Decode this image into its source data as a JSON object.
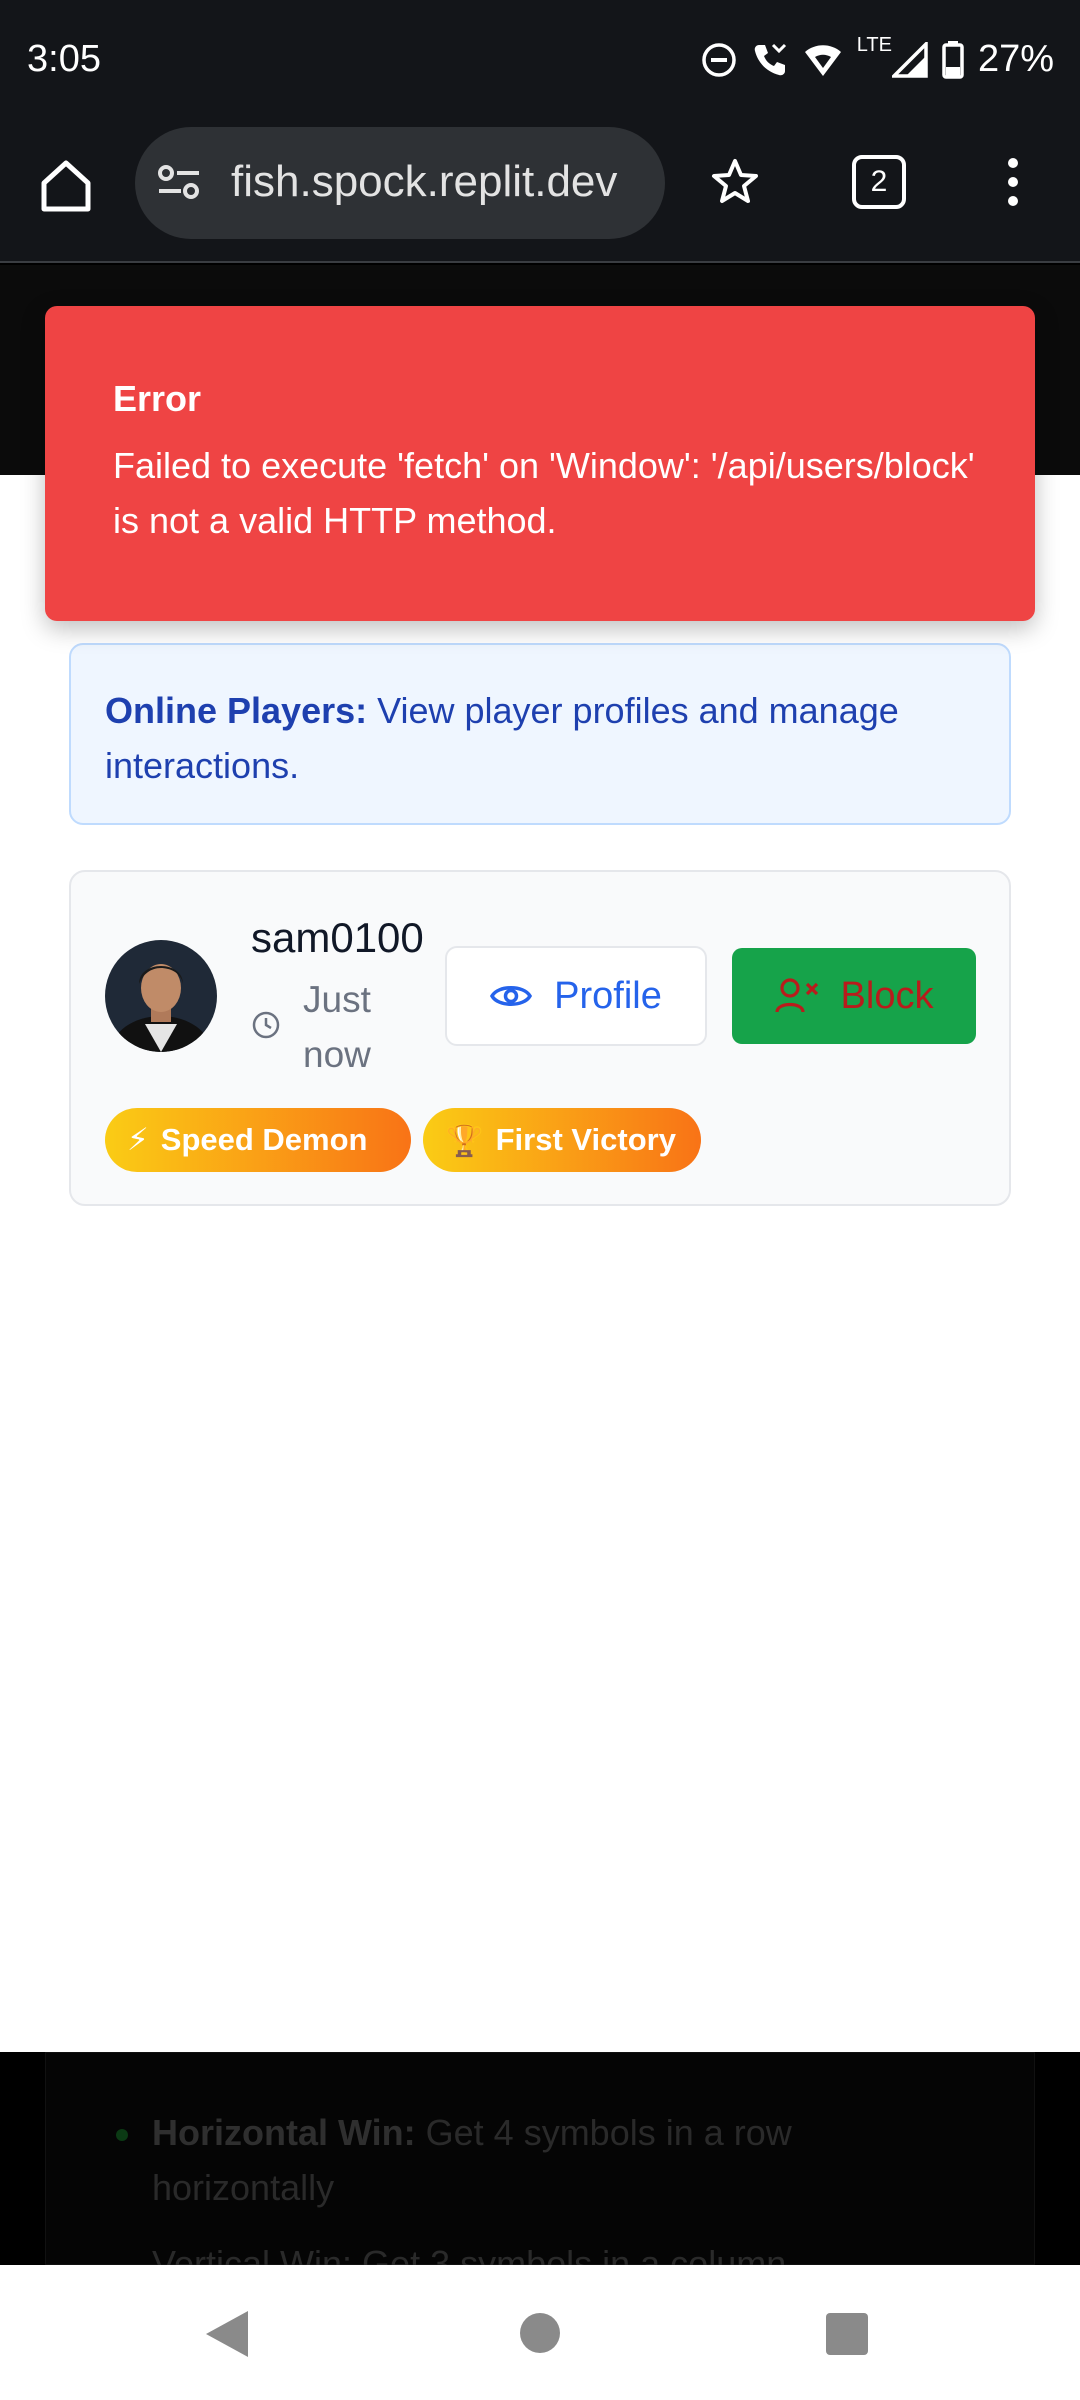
{
  "status_bar": {
    "time": "3:05",
    "network": "LTE",
    "battery": "27%"
  },
  "browser": {
    "url": "fish.spock.replit.dev",
    "tab_count": "2"
  },
  "toast": {
    "title": "Error",
    "message": "Failed to execute 'fetch' on 'Window': '/api/users/block' is not a valid HTTP method.",
    "color": "#ef4444"
  },
  "info_banner": {
    "label": "Online Players:",
    "text": " View player profiles and manage interactions."
  },
  "player": {
    "username": "sam0100",
    "last_seen": "Just now",
    "profile_label": "Profile",
    "block_label": "Block",
    "badges": [
      {
        "icon": "⚡",
        "label": "Speed Demon"
      },
      {
        "icon": "🏆",
        "label": "First Victory"
      }
    ]
  },
  "rules": {
    "item1_title": "Horizontal Win:",
    "item1_text": " Get 4 symbols in a row horizontally",
    "item2_text": "Vertical Win: Get 3 symbols in a column"
  },
  "colors": {
    "accent_blue": "#2563eb",
    "block_green": "#16a34a",
    "block_text_red": "#b91c1c"
  }
}
